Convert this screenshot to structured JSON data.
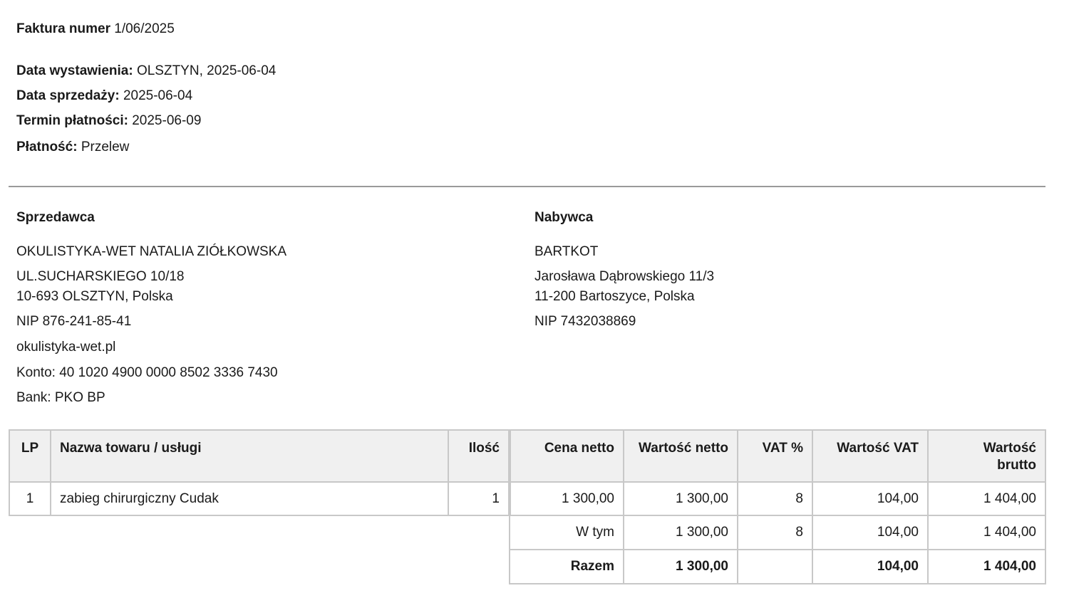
{
  "header": {
    "invoice_label": "Faktura numer",
    "invoice_number": "1/06/2025",
    "issue_label": "Data wystawienia:",
    "issue_value": "OLSZTYN, 2025-06-04",
    "sale_label": "Data sprzedaży:",
    "sale_value": "2025-06-04",
    "due_label": "Termin płatności:",
    "due_value": "2025-06-09",
    "payment_label": "Płatność:",
    "payment_value": "Przelew"
  },
  "seller": {
    "title": "Sprzedawca",
    "name": "OKULISTYKA-WET NATALIA ZIÓŁKOWSKA",
    "street": "UL.SUCHARSKIEGO 10/18",
    "city": "10-693 OLSZTYN, Polska",
    "nip": "NIP 876-241-85-41",
    "website": "okulistyka-wet.pl",
    "account": "Konto: 40 1020 4900 0000 8502 3336 7430",
    "bank": "Bank: PKO BP"
  },
  "buyer": {
    "title": "Nabywca",
    "name": "BARTKOT",
    "street": "Jarosława Dąbrowskiego 11/3",
    "city": "11-200 Bartoszyce, Polska",
    "nip": "NIP 7432038869"
  },
  "table": {
    "headers": {
      "lp": "LP",
      "name": "Nazwa towaru / usługi",
      "qty": "Ilość",
      "net_price": "Cena netto",
      "net_value": "Wartość netto",
      "vat_rate": "VAT %",
      "vat_value": "Wartość VAT",
      "gross_value_1": "Wartość",
      "gross_value_2": "brutto"
    },
    "rows": [
      {
        "lp": "1",
        "name": "zabieg chirurgiczny Cudak",
        "qty": "1",
        "net_price": "1 300,00",
        "net_value": "1 300,00",
        "vat_rate": "8",
        "vat_value": "104,00",
        "gross_value": "1 404,00"
      }
    ],
    "including": {
      "label": "W tym",
      "net_value": "1 300,00",
      "vat_rate": "8",
      "vat_value": "104,00",
      "gross_value": "1 404,00"
    },
    "total": {
      "label": "Razem",
      "net_value": "1 300,00",
      "vat_rate": "",
      "vat_value": "104,00",
      "gross_value": "1 404,00"
    }
  }
}
